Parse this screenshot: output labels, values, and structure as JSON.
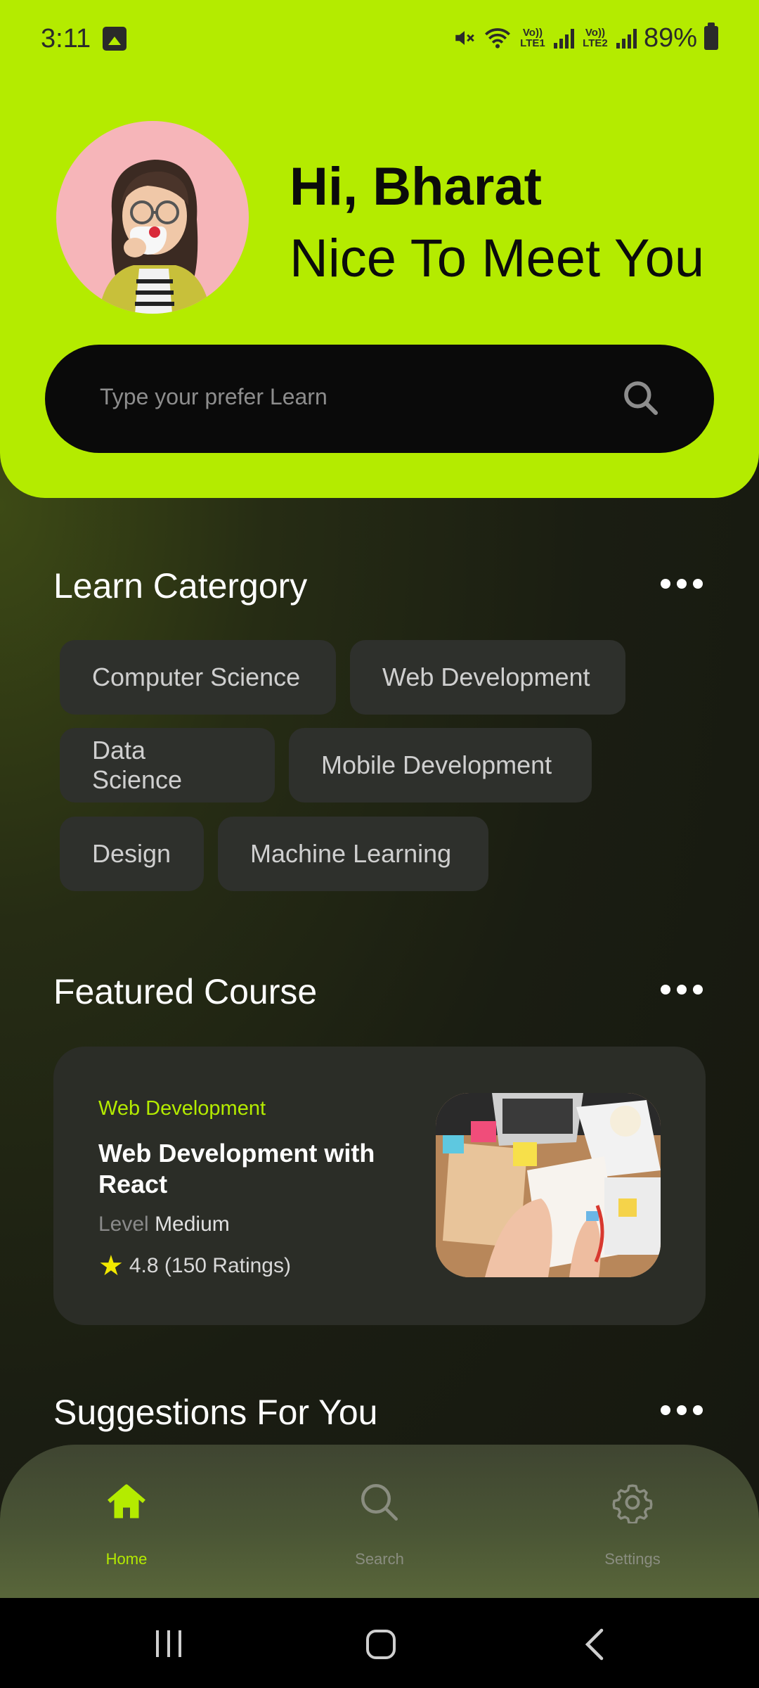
{
  "status": {
    "time": "3:11",
    "lte1": "Vo)) LTE1",
    "lte2": "Vo)) LTE2",
    "battery": "89%"
  },
  "header": {
    "greeting_name": "Hi, Bharat",
    "greeting_sub": "Nice To Meet You",
    "search_placeholder": "Type your prefer Learn"
  },
  "categories": {
    "title": "Learn Catergory",
    "items": [
      "Computer Science",
      "Web Development",
      "Data Science",
      "Mobile Development",
      "Design",
      "Machine Learning"
    ]
  },
  "featured": {
    "title": "Featured Course",
    "course": {
      "category": "Web Development",
      "title": "Web Development with React",
      "level_label": "Level",
      "level_value": "Medium",
      "rating": "4.8 (150 Ratings)"
    }
  },
  "suggestions": {
    "title": "Suggestions For You"
  },
  "nav": {
    "home": "Home",
    "search": "Search",
    "settings": "Settings"
  },
  "colors": {
    "accent": "#b4eb00",
    "card": "#2b2d27",
    "chip": "#2e302c"
  }
}
